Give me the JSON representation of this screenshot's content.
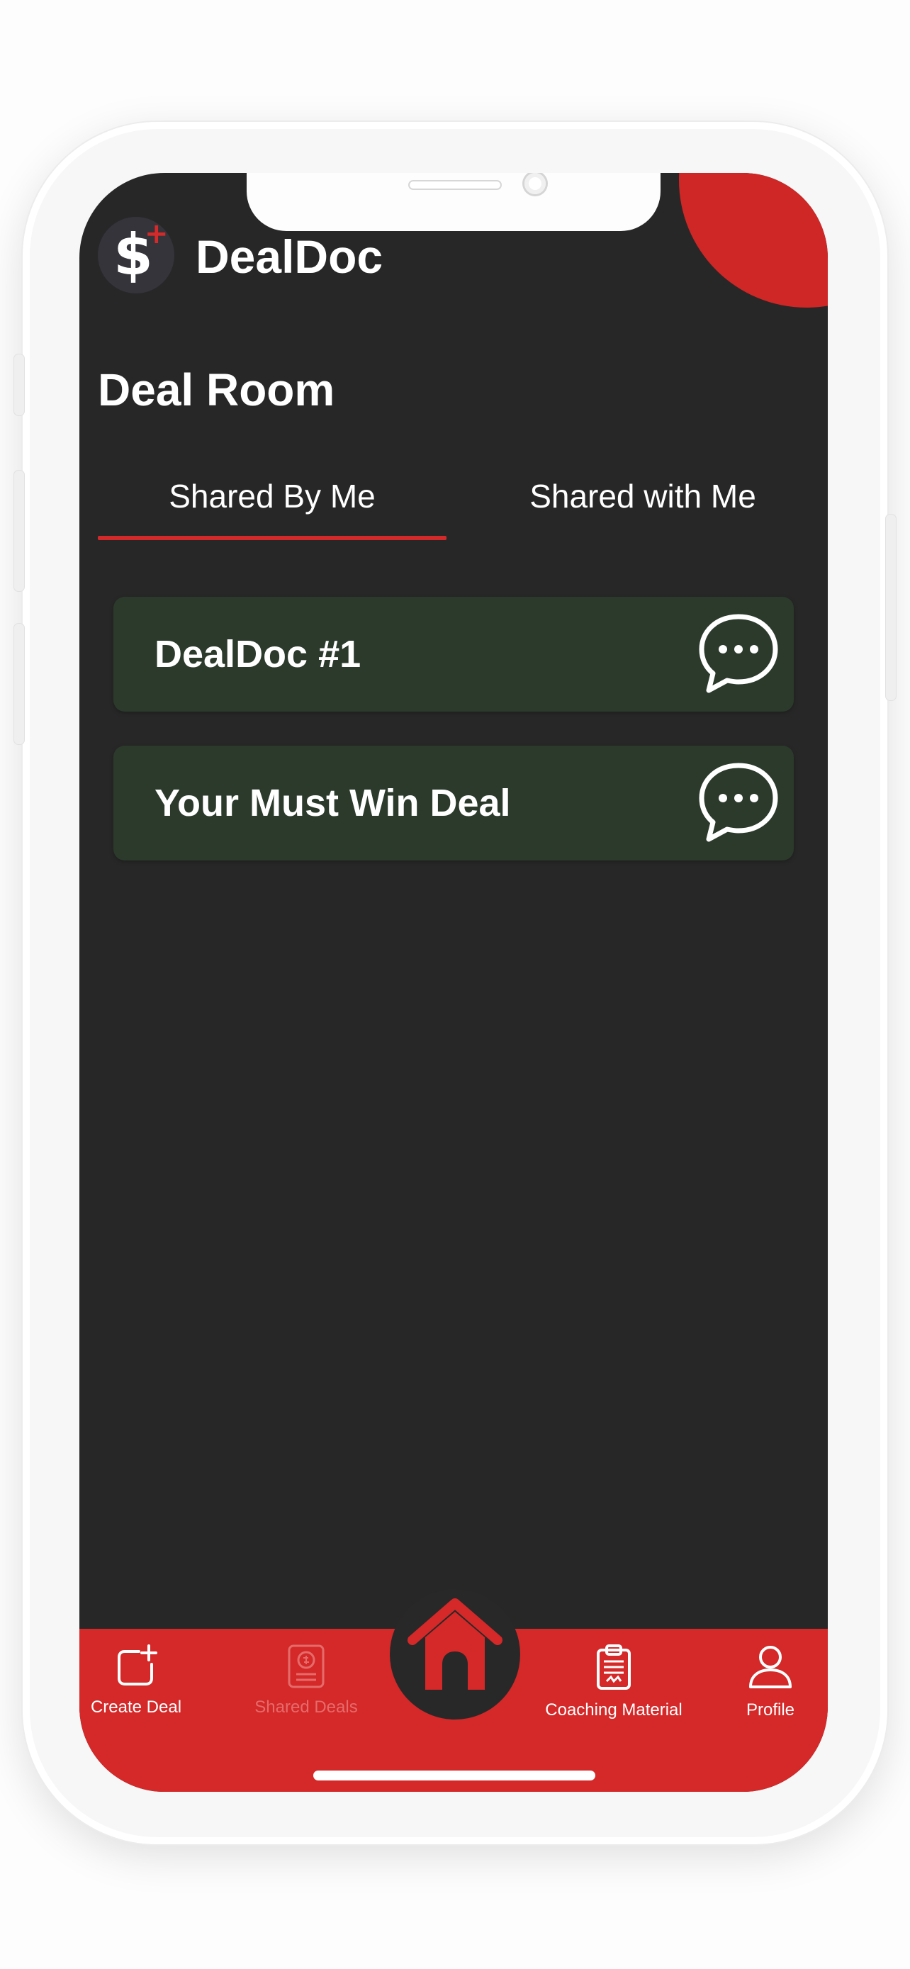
{
  "app": {
    "name": "DealDoc",
    "logo_symbol": "$",
    "logo_badge": "+",
    "accent_color": "#d52828",
    "background_color": "#272727"
  },
  "page": {
    "title": "Deal Room"
  },
  "tabs": [
    {
      "label": "Shared By Me",
      "active": true
    },
    {
      "label": "Shared with Me",
      "active": false
    }
  ],
  "deals": [
    {
      "title": "DealDoc #1",
      "icon": "chat-bubble-icon"
    },
    {
      "title": "Your Must Win Deal",
      "icon": "chat-bubble-icon"
    }
  ],
  "nav": {
    "items": [
      {
        "label": "Create Deal",
        "icon": "create-deal-icon",
        "muted": false
      },
      {
        "label": "Shared Deals",
        "icon": "shared-deals-icon",
        "muted": true
      },
      {
        "label": "",
        "icon": "home-icon",
        "muted": false
      },
      {
        "label": "Coaching Material",
        "icon": "clipboard-icon",
        "muted": false
      },
      {
        "label": "Profile",
        "icon": "profile-icon",
        "muted": false
      }
    ]
  }
}
